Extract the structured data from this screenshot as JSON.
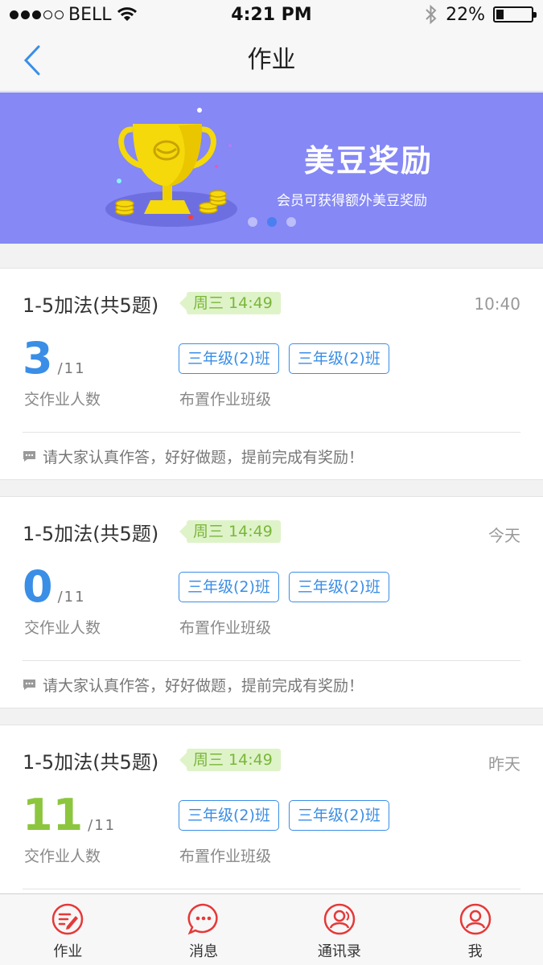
{
  "status_bar": {
    "carrier": "BELL",
    "time": "4:21 PM",
    "battery": "22%",
    "battery_level": 0.22,
    "signal_bars": 3,
    "signal_total": 5
  },
  "nav": {
    "title": "作业",
    "back_icon": "chevron-left-icon"
  },
  "banner": {
    "title": "美豆奖励",
    "subtitle": "会员可获得额外美豆奖励",
    "page_count": 3,
    "active_page": 2
  },
  "assignments": [
    {
      "title": "1-5加法(共5题)",
      "due": "周三 14:49",
      "date": "10:40",
      "submitted": "3",
      "total": "/11",
      "submitted_label": "交作业人数",
      "count_color": "#3a8ee6",
      "classes": [
        "三年级(2)班",
        "三年级(2)班"
      ],
      "classes_label": "布置作业班级",
      "note": "请大家认真作答，好好做题，提前完成有奖励！"
    },
    {
      "title": "1-5加法(共5题)",
      "due": "周三 14:49",
      "date": "今天",
      "submitted": "0",
      "total": "/11",
      "submitted_label": "交作业人数",
      "count_color": "#3a8ee6",
      "classes": [
        "三年级(2)班",
        "三年级(2)班"
      ],
      "classes_label": "布置作业班级",
      "note": "请大家认真作答，好好做题，提前完成有奖励！"
    },
    {
      "title": "1-5加法(共5题)",
      "due": "周三 14:49",
      "date": "昨天",
      "submitted": "11",
      "total": "/11",
      "submitted_label": "交作业人数",
      "count_color": "#8cc63e",
      "classes": [
        "三年级(2)班",
        "三年级(2)班"
      ],
      "classes_label": "布置作业班级",
      "note": ""
    }
  ],
  "tab_bar": {
    "accent": "#e63838",
    "items": [
      {
        "label": "作业",
        "icon": "homework-icon"
      },
      {
        "label": "消息",
        "icon": "message-icon"
      },
      {
        "label": "通讯录",
        "icon": "contacts-icon"
      },
      {
        "label": "我",
        "icon": "profile-icon"
      }
    ]
  }
}
